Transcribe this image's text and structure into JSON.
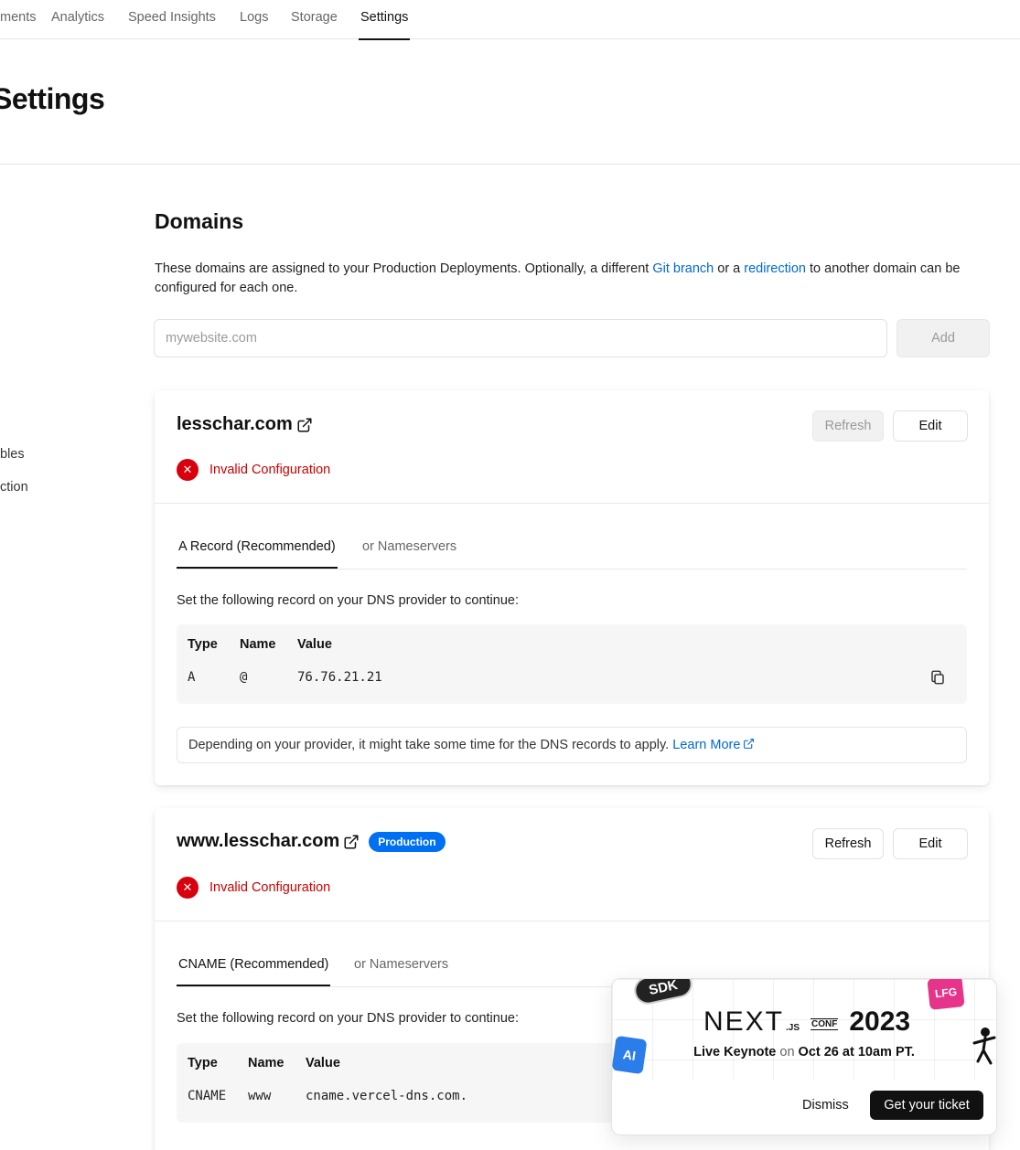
{
  "nav": {
    "tabs": [
      {
        "label": "ments"
      },
      {
        "label": "Analytics"
      },
      {
        "label": "Speed Insights"
      },
      {
        "label": "Logs"
      },
      {
        "label": "Storage"
      },
      {
        "label": "Settings",
        "active": true
      }
    ]
  },
  "page": {
    "title": "Settings"
  },
  "sidebar": {
    "items": [
      {
        "label": "bles"
      },
      {
        "label": "ction"
      }
    ]
  },
  "domains": {
    "title": "Domains",
    "desc_before": "These domains are assigned to your Production Deployments. Optionally, a different ",
    "link_git": "Git branch",
    "desc_middle": " or a ",
    "link_redirect": "redirection",
    "desc_after": " to another domain can be configured for each one.",
    "input_placeholder": "mywebsite.com",
    "input_value": "",
    "add_label": "Add"
  },
  "cards": [
    {
      "domain": "lesschar.com",
      "badge": "",
      "refresh_label": "Refresh",
      "edit_label": "Edit",
      "status": "Invalid Configuration",
      "tab_primary": "A Record (Recommended)",
      "tab_secondary": "or Nameservers",
      "instruction": "Set the following record on your DNS provider to continue:",
      "headers": {
        "type": "Type",
        "name": "Name",
        "value": "Value"
      },
      "record": {
        "type": "A",
        "name": "@",
        "value": "76.76.21.21"
      },
      "note": "Depending on your provider, it might take some time for the DNS records to apply.",
      "note_link": "Learn More"
    },
    {
      "domain": "www.lesschar.com",
      "badge": "Production",
      "refresh_label": "Refresh",
      "edit_label": "Edit",
      "status": "Invalid Configuration",
      "tab_primary": "CNAME (Recommended)",
      "tab_secondary": "or Nameservers",
      "instruction": "Set the following record on your DNS provider to continue:",
      "headers": {
        "type": "Type",
        "name": "Name",
        "value": "Value"
      },
      "record": {
        "type": "CNAME",
        "name": "www",
        "value": "cname.vercel-dns.com."
      }
    }
  ],
  "promo": {
    "next": "NEXT",
    "js": ".JS",
    "conf": "CONF",
    "year": "2023",
    "tagline_before": "Live Keynote",
    "tagline_on": "on",
    "tagline_after": "Oct 26 at 10am PT.",
    "stickers": {
      "sdk": "SDK",
      "ai": "AI",
      "lfg": "LFG"
    },
    "dismiss_label": "Dismiss",
    "ticket_label": "Get your ticket"
  },
  "colors": {
    "accent": "#0070f3",
    "link": "#0068d6",
    "error": "#d8000c"
  }
}
